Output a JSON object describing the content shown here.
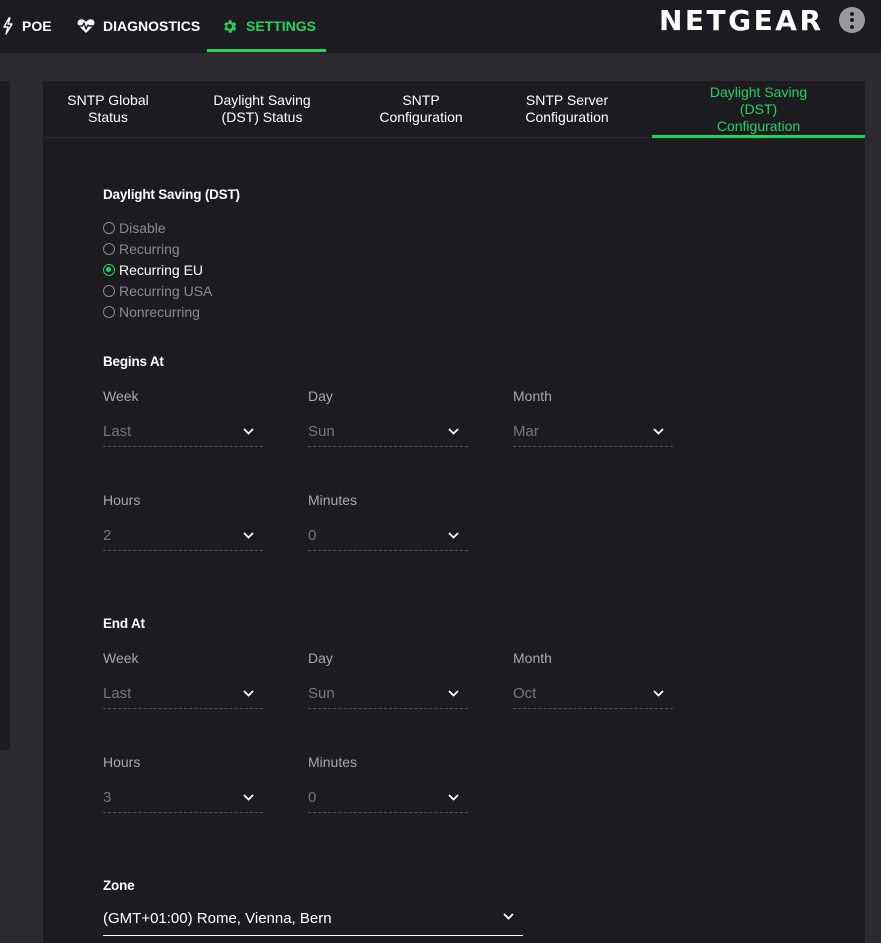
{
  "topnav": {
    "items": [
      {
        "label": "POE",
        "icon": "bolt-icon"
      },
      {
        "label": "DIAGNOSTICS",
        "icon": "heart-pulse-icon"
      },
      {
        "label": "SETTINGS",
        "icon": "gear-icon",
        "active": true
      }
    ],
    "logo": "NETGEAR",
    "menu_icon": "kebab-menu-icon",
    "accent_color": "#22d45f"
  },
  "tabs": [
    {
      "label": "SNTP Global Status"
    },
    {
      "label": "Daylight Saving (DST) Status"
    },
    {
      "label": "SNTP Configuration"
    },
    {
      "label": "SNTP Server Configuration"
    },
    {
      "label": "Daylight Saving (DST) Configuration",
      "active": true
    }
  ],
  "dst": {
    "title": "Daylight Saving (DST)",
    "options": [
      "Disable",
      "Recurring",
      "Recurring EU",
      "Recurring USA",
      "Nonrecurring"
    ],
    "selected": "Recurring EU"
  },
  "begins": {
    "title": "Begins At",
    "week_label": "Week",
    "week": "Last",
    "day_label": "Day",
    "day": "Sun",
    "month_label": "Month",
    "month": "Mar",
    "hours_label": "Hours",
    "hours": "2",
    "minutes_label": "Minutes",
    "minutes": "0"
  },
  "ends": {
    "title": "End At",
    "week_label": "Week",
    "week": "Last",
    "day_label": "Day",
    "day": "Sun",
    "month_label": "Month",
    "month": "Oct",
    "hours_label": "Hours",
    "hours": "3",
    "minutes_label": "Minutes",
    "minutes": "0"
  },
  "zone": {
    "title": "Zone",
    "value": "(GMT+01:00) Rome, Vienna, Bern"
  }
}
